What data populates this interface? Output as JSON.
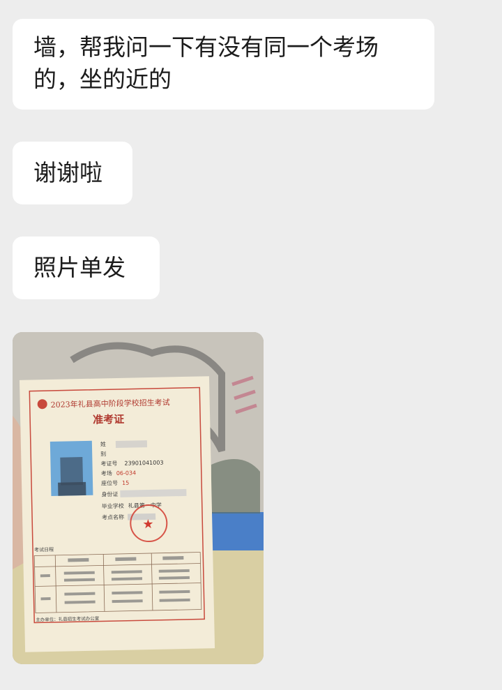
{
  "messages": [
    {
      "text": "墙，帮我问一下有没有同一个考场的，坐的近的"
    },
    {
      "text": "谢谢啦"
    },
    {
      "text": "照片单发"
    }
  ],
  "photo": {
    "card_header": "2023年礼县高中阶段学校招生考试",
    "card_title": "准考证",
    "fields": [
      {
        "label": "姓",
        "value": ""
      },
      {
        "label": "别",
        "value": ""
      },
      {
        "label": "考证号",
        "value": "23901041003"
      },
      {
        "label": "考场",
        "value": "06-034"
      },
      {
        "label": "座位号",
        "value": "15"
      },
      {
        "label": "身份证",
        "value": ""
      },
      {
        "label": "毕业学校",
        "value": "礼县第一中学"
      },
      {
        "label": "考点名称",
        "value": ""
      }
    ],
    "schedule_label": "考试日程",
    "stamp_star": "★",
    "footer": "主办单位：礼县招生考试办公室"
  }
}
